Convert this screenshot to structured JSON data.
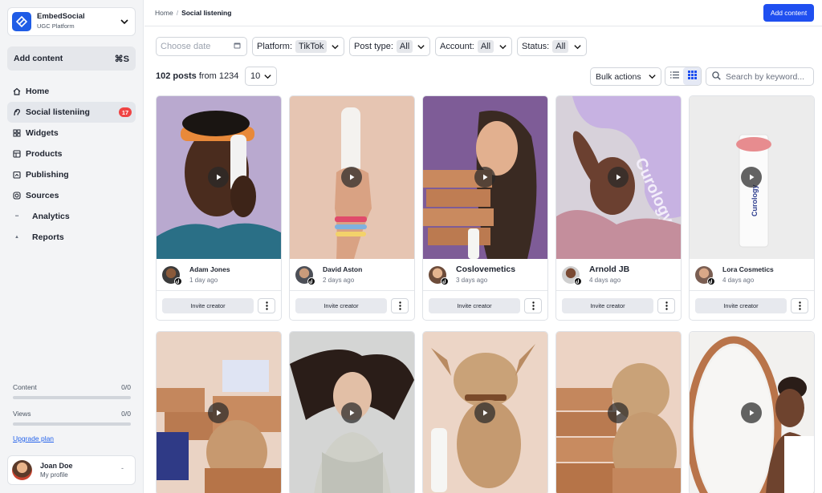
{
  "brand": {
    "name": "EmbedSocial",
    "subtitle": "UGC Platform"
  },
  "sidebar": {
    "add_content_label": "Add content",
    "add_content_shortcut": "⌘S",
    "nav": [
      {
        "label": "Home",
        "icon": "home-icon"
      },
      {
        "label": "Social listeniing",
        "icon": "listening-icon",
        "badge": "17"
      },
      {
        "label": "Widgets",
        "icon": "widgets-icon"
      },
      {
        "label": "Products",
        "icon": "products-icon"
      },
      {
        "label": "Publishing",
        "icon": "publishing-icon"
      },
      {
        "label": "Sources",
        "icon": "sources-icon"
      },
      {
        "label": "Analytics",
        "icon": "analytics-icon"
      },
      {
        "label": "Reports",
        "icon": "reports-icon"
      }
    ],
    "usage": [
      {
        "label": "Content",
        "value": "0/0",
        "fraction": 0
      },
      {
        "label": "Views",
        "value": "0/0",
        "fraction": 0
      }
    ],
    "upgrade_label": "Upgrade plan",
    "profile": {
      "name": "Joan Doe",
      "sub": "My profile",
      "dash": "-"
    }
  },
  "topbar": {
    "breadcrumb_home": "Home",
    "breadcrumb_sep": "/",
    "breadcrumb_current": "Social listening",
    "add_content_label": "Add content"
  },
  "filters": {
    "date_placeholder": "Choose date",
    "platform_label": "Platform:",
    "platform_value": "TikTok",
    "post_type_label": "Post type:",
    "post_type_value": "All",
    "account_label": "Account:",
    "account_value": "All",
    "status_label": "Status:",
    "status_value": "All"
  },
  "list": {
    "count": "102 posts",
    "from_label": "from 1234",
    "per_page": "10",
    "bulk_label": "Bulk actions",
    "search_placeholder": "Search by keyword..."
  },
  "cards": [
    {
      "name": "Adam Jones",
      "time": "1 day ago",
      "invite": "Invite creator"
    },
    {
      "name": "David Aston",
      "time": "2 days ago",
      "invite": "Invite creator"
    },
    {
      "name": "Coslovemetics",
      "time": "3 days ago",
      "invite": "Invite creator"
    },
    {
      "name": "Arnold JB",
      "time": "4 days ago",
      "invite": "Invite creator"
    },
    {
      "name": "Lora Cosmetics",
      "time": "4 days ago",
      "invite": "Invite creator"
    }
  ],
  "media_text": {
    "product_brand": "Curology"
  },
  "colors": {
    "primary": "#1f4ff0",
    "badge": "#ef4444",
    "sidebar_bg": "#f3f4f6"
  }
}
